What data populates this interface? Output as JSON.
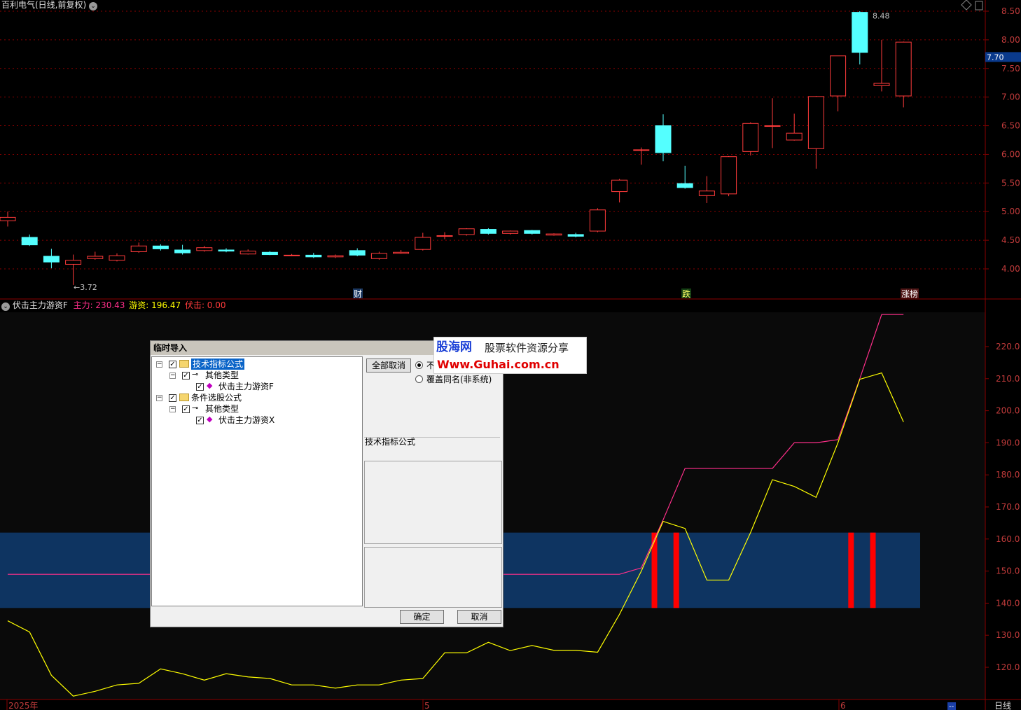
{
  "upper": {
    "title": "百利电气(日线,前复权)",
    "price_ticks": [
      "8.50",
      "8.00",
      "7.50",
      "7.00",
      "6.50",
      "6.00",
      "5.50",
      "5.00",
      "4.50",
      "4.00"
    ],
    "current_price": "7.70",
    "high_label": "8.48",
    "low_label": "←3.72",
    "markers": [
      "财",
      "跌",
      "涨榜"
    ]
  },
  "lower": {
    "title": "伏击主力游资F",
    "main_label": "主力: 230.43",
    "hot_label": "游资: 196.47",
    "ambush_label": "伏击: 0.00",
    "ticks": [
      "220.0",
      "210.0",
      "200.0",
      "190.0",
      "180.0",
      "170.0",
      "160.0",
      "150.0",
      "140.0",
      "130.0",
      "120.0"
    ]
  },
  "bottom": {
    "labels": [
      "2025年",
      "5",
      "6"
    ],
    "right_label": "日线",
    "dash": "--"
  },
  "colors": {
    "up": "#ff3b3b",
    "down": "#54ffff",
    "main_line": "#ff2f8a",
    "hot_line": "#ffff00",
    "band": "#0e3461",
    "signal": "#ff0000",
    "grid": "#8b0000"
  },
  "dialog": {
    "title": "临时导入",
    "tree": [
      {
        "text": "技术指标公式",
        "icon": "folder-icon",
        "selected": true
      },
      {
        "text": "其他类型",
        "icon": "key-icon"
      },
      {
        "text": "伏击主力游资F",
        "icon": "formula-icon"
      },
      {
        "text": "条件选股公式",
        "icon": "folder-icon"
      },
      {
        "text": "其他类型",
        "icon": "key-icon"
      },
      {
        "text": "伏击主力游资X",
        "icon": "formula-icon"
      }
    ],
    "cancel_all": "全部取消",
    "radio1": "不",
    "radio2": "覆盖同名(非系统)",
    "info_title": "技术指标公式",
    "ok": "确定",
    "cancel": "取消"
  },
  "watermark": {
    "logo": "股海网",
    "slogan": "股票软件资源分享",
    "url": "Www.Guhai.com.cn"
  },
  "chart_data": [
    {
      "type": "candlestick",
      "title": "百利电气(日线,前复权)",
      "ylim": [
        3.6,
        8.6
      ],
      "candles": [
        {
          "o": 4.84,
          "c": 4.9,
          "h": 5.0,
          "l": 4.74
        },
        {
          "o": 4.55,
          "c": 4.42,
          "h": 4.6,
          "l": 4.4
        },
        {
          "o": 4.22,
          "c": 4.12,
          "h": 4.35,
          "l": 4.01
        },
        {
          "o": 4.08,
          "c": 4.15,
          "h": 4.25,
          "l": 3.72
        },
        {
          "o": 4.18,
          "c": 4.22,
          "h": 4.3,
          "l": 4.16
        },
        {
          "o": 4.15,
          "c": 4.23,
          "h": 4.27,
          "l": 4.13
        },
        {
          "o": 4.3,
          "c": 4.4,
          "h": 4.46,
          "l": 4.28
        },
        {
          "o": 4.4,
          "c": 4.35,
          "h": 4.43,
          "l": 4.32
        },
        {
          "o": 4.33,
          "c": 4.28,
          "h": 4.42,
          "l": 4.25
        },
        {
          "o": 4.32,
          "c": 4.37,
          "h": 4.4,
          "l": 4.3
        },
        {
          "o": 4.33,
          "c": 4.31,
          "h": 4.36,
          "l": 4.29
        },
        {
          "o": 4.26,
          "c": 4.31,
          "h": 4.34,
          "l": 4.25
        },
        {
          "o": 4.29,
          "c": 4.25,
          "h": 4.31,
          "l": 4.24
        },
        {
          "o": 4.23,
          "c": 4.24,
          "h": 4.26,
          "l": 4.22
        },
        {
          "o": 4.24,
          "c": 4.21,
          "h": 4.28,
          "l": 4.19
        },
        {
          "o": 4.21,
          "c": 4.23,
          "h": 4.25,
          "l": 4.19
        },
        {
          "o": 4.32,
          "c": 4.24,
          "h": 4.36,
          "l": 4.22
        },
        {
          "o": 4.18,
          "c": 4.27,
          "h": 4.3,
          "l": 4.16
        },
        {
          "o": 4.27,
          "c": 4.29,
          "h": 4.33,
          "l": 4.26
        },
        {
          "o": 4.34,
          "c": 4.55,
          "h": 4.63,
          "l": 4.32
        },
        {
          "o": 4.57,
          "c": 4.58,
          "h": 4.64,
          "l": 4.52
        },
        {
          "o": 4.6,
          "c": 4.7,
          "h": 4.71,
          "l": 4.58
        },
        {
          "o": 4.69,
          "c": 4.62,
          "h": 4.71,
          "l": 4.6
        },
        {
          "o": 4.62,
          "c": 4.66,
          "h": 4.67,
          "l": 4.6
        },
        {
          "o": 4.67,
          "c": 4.62,
          "h": 4.68,
          "l": 4.6
        },
        {
          "o": 4.59,
          "c": 4.61,
          "h": 4.62,
          "l": 4.58
        },
        {
          "o": 4.6,
          "c": 4.57,
          "h": 4.63,
          "l": 4.55
        },
        {
          "o": 4.66,
          "c": 5.03,
          "h": 5.06,
          "l": 4.64
        },
        {
          "o": 5.35,
          "c": 5.55,
          "h": 5.57,
          "l": 5.16
        },
        {
          "o": 6.07,
          "c": 6.08,
          "h": 6.12,
          "l": 5.82
        },
        {
          "o": 6.5,
          "c": 6.03,
          "h": 6.7,
          "l": 5.88
        },
        {
          "o": 5.49,
          "c": 5.42,
          "h": 5.8,
          "l": 5.4
        },
        {
          "o": 5.28,
          "c": 5.36,
          "h": 5.62,
          "l": 5.15
        },
        {
          "o": 5.31,
          "c": 5.96,
          "h": 5.97,
          "l": 5.27
        },
        {
          "o": 6.05,
          "c": 6.54,
          "h": 6.56,
          "l": 5.98
        },
        {
          "o": 6.49,
          "c": 6.5,
          "h": 6.98,
          "l": 6.11
        },
        {
          "o": 6.25,
          "c": 6.37,
          "h": 6.71,
          "l": 6.24
        },
        {
          "o": 6.1,
          "c": 7.01,
          "h": 7.02,
          "l": 5.75
        },
        {
          "o": 7.02,
          "c": 7.72,
          "h": 7.72,
          "l": 6.75
        },
        {
          "o": 8.48,
          "c": 7.78,
          "h": 8.5,
          "l": 7.57
        },
        {
          "o": 7.2,
          "c": 7.24,
          "h": 8.0,
          "l": 7.1
        },
        {
          "o": 7.02,
          "c": 7.96,
          "h": 7.97,
          "l": 6.82
        }
      ]
    },
    {
      "type": "line",
      "title": "伏击主力游资F",
      "ylim": [
        115,
        233
      ],
      "series": [
        {
          "name": "主力",
          "values": [
            149,
            149,
            149,
            149,
            149,
            149,
            149,
            149,
            149,
            149,
            149,
            149,
            149,
            149,
            149,
            149,
            149,
            149,
            149,
            149,
            149,
            149,
            149,
            149,
            149,
            149,
            149,
            149,
            149,
            151,
            166,
            182,
            182,
            182,
            182,
            182,
            190,
            190,
            191,
            210,
            230,
            230
          ]
        },
        {
          "name": "游资",
          "values": [
            134.5,
            131,
            117.5,
            111,
            112.5,
            114.5,
            115,
            119.5,
            118,
            116,
            118,
            117,
            116.5,
            114.5,
            114.5,
            113.5,
            114.5,
            114.5,
            116,
            116.5,
            124.5,
            124.5,
            127.8,
            125.2,
            126.8,
            125.3,
            125.3,
            124.7,
            136.5,
            150,
            165.5,
            163.3,
            147.2,
            147.2,
            162,
            178.5,
            176.4,
            173,
            190,
            209.8,
            211.8,
            196.5
          ]
        }
      ],
      "band": [
        138.5,
        162
      ],
      "signal_bars": [
        29.6,
        30.6,
        38.6,
        39.6
      ]
    }
  ]
}
